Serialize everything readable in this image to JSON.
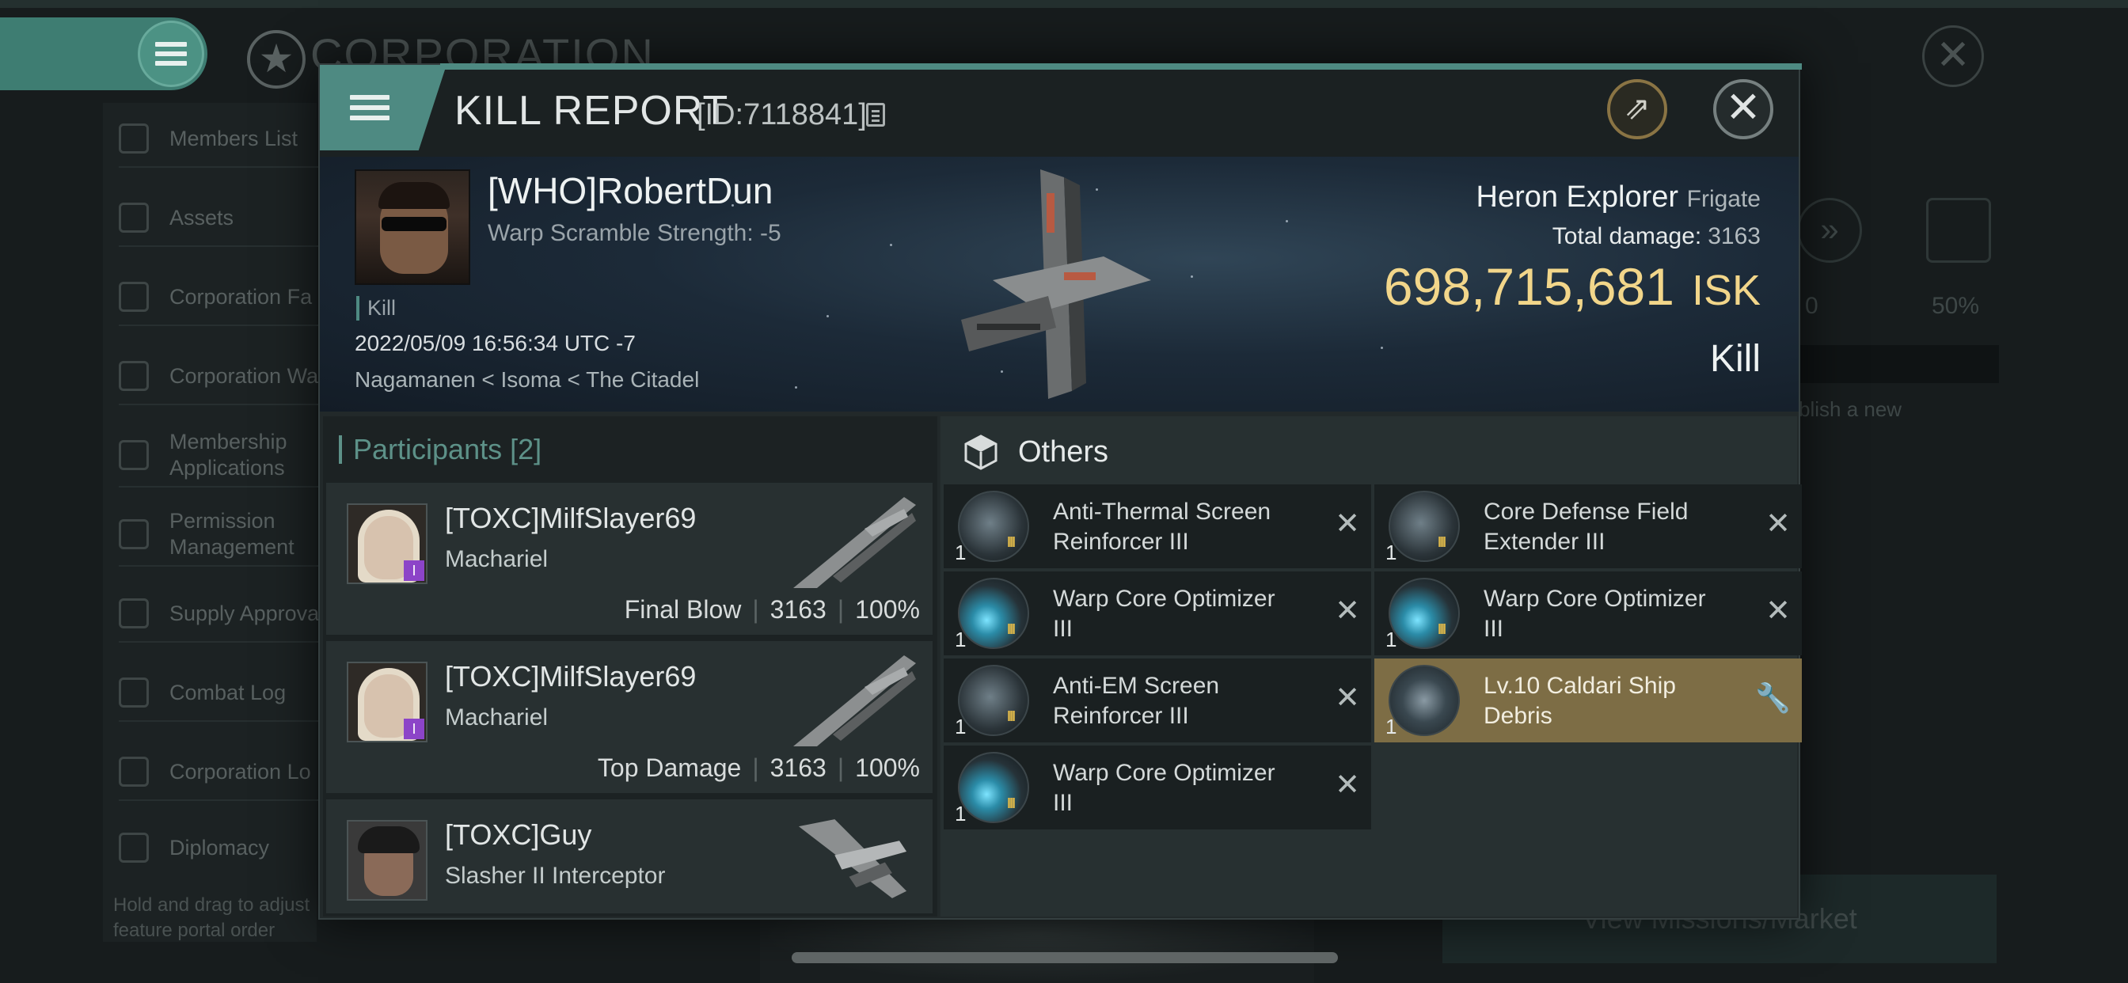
{
  "background": {
    "title": "CORPORATION",
    "sidebar": [
      "Members List",
      "Assets",
      "Corporation Fa",
      "Corporation Wa",
      "Membership\nApplications",
      "Permission\nManagement",
      "Supply Approva",
      "Combat Log",
      "Corporation Lo",
      "Diplomacy"
    ],
    "hint": "Hold and drag to adjust\nfeature portal order",
    "right_value_1": "0",
    "right_value_2": "50%",
    "right_hint": "blish a new",
    "bottom_button": "View Missions/Market"
  },
  "report": {
    "title": "KILL REPORT",
    "id": "[ID:7118841]",
    "victim": {
      "name": "[WHO]RobertDun",
      "warp_scramble": "Warp Scramble Strength: -5",
      "tag": "Kill",
      "datetime": "2022/05/09 16:56:34 UTC -7",
      "location": "Nagamanen < Isoma < The Citadel"
    },
    "ship": {
      "name": "Heron Explorer",
      "class": "Frigate",
      "total_damage_label": "Total damage:",
      "total_damage": "3163",
      "isk_value": "698,715,681",
      "isk_unit": "ISK",
      "result": "Kill"
    },
    "participants": {
      "title": "Participants",
      "count": "[2]",
      "rows": [
        {
          "name": "[TOXC]MilfSlayer69",
          "ship": "Machariel",
          "role": "Final Blow",
          "damage": "3163",
          "percent": "100%",
          "badge": "I"
        },
        {
          "name": "[TOXC]MilfSlayer69",
          "ship": "Machariel",
          "role": "Top Damage",
          "damage": "3163",
          "percent": "100%",
          "badge": "I"
        },
        {
          "name": "[TOXC]Guy",
          "ship": "Slasher II Interceptor"
        }
      ]
    },
    "others": {
      "title": "Others",
      "items": [
        {
          "name": "Anti-Thermal Screen\nReinforcer III",
          "qty": "1",
          "tier": "III",
          "icon": "shield-module-icon",
          "status": "destroyed"
        },
        {
          "name": "Core Defense Field\nExtender III",
          "qty": "1",
          "tier": "III",
          "icon": "shield-module-icon",
          "status": "destroyed"
        },
        {
          "name": "Warp Core Optimizer\nIII",
          "qty": "1",
          "tier": "III",
          "icon": "warp-core-icon",
          "status": "destroyed"
        },
        {
          "name": "Warp Core Optimizer\nIII",
          "qty": "1",
          "tier": "III",
          "icon": "warp-core-icon",
          "status": "destroyed"
        },
        {
          "name": "Anti-EM Screen\nReinforcer III",
          "qty": "1",
          "tier": "III",
          "icon": "shield-module-icon",
          "status": "destroyed"
        },
        {
          "name": "Lv.10 Caldari Ship\nDebris",
          "qty": "1",
          "tier": "",
          "icon": "debris-icon",
          "status": "dropped"
        },
        {
          "name": "Warp Core Optimizer\nIII",
          "qty": "1",
          "tier": "III",
          "icon": "warp-core-icon",
          "status": "destroyed"
        }
      ]
    }
  }
}
